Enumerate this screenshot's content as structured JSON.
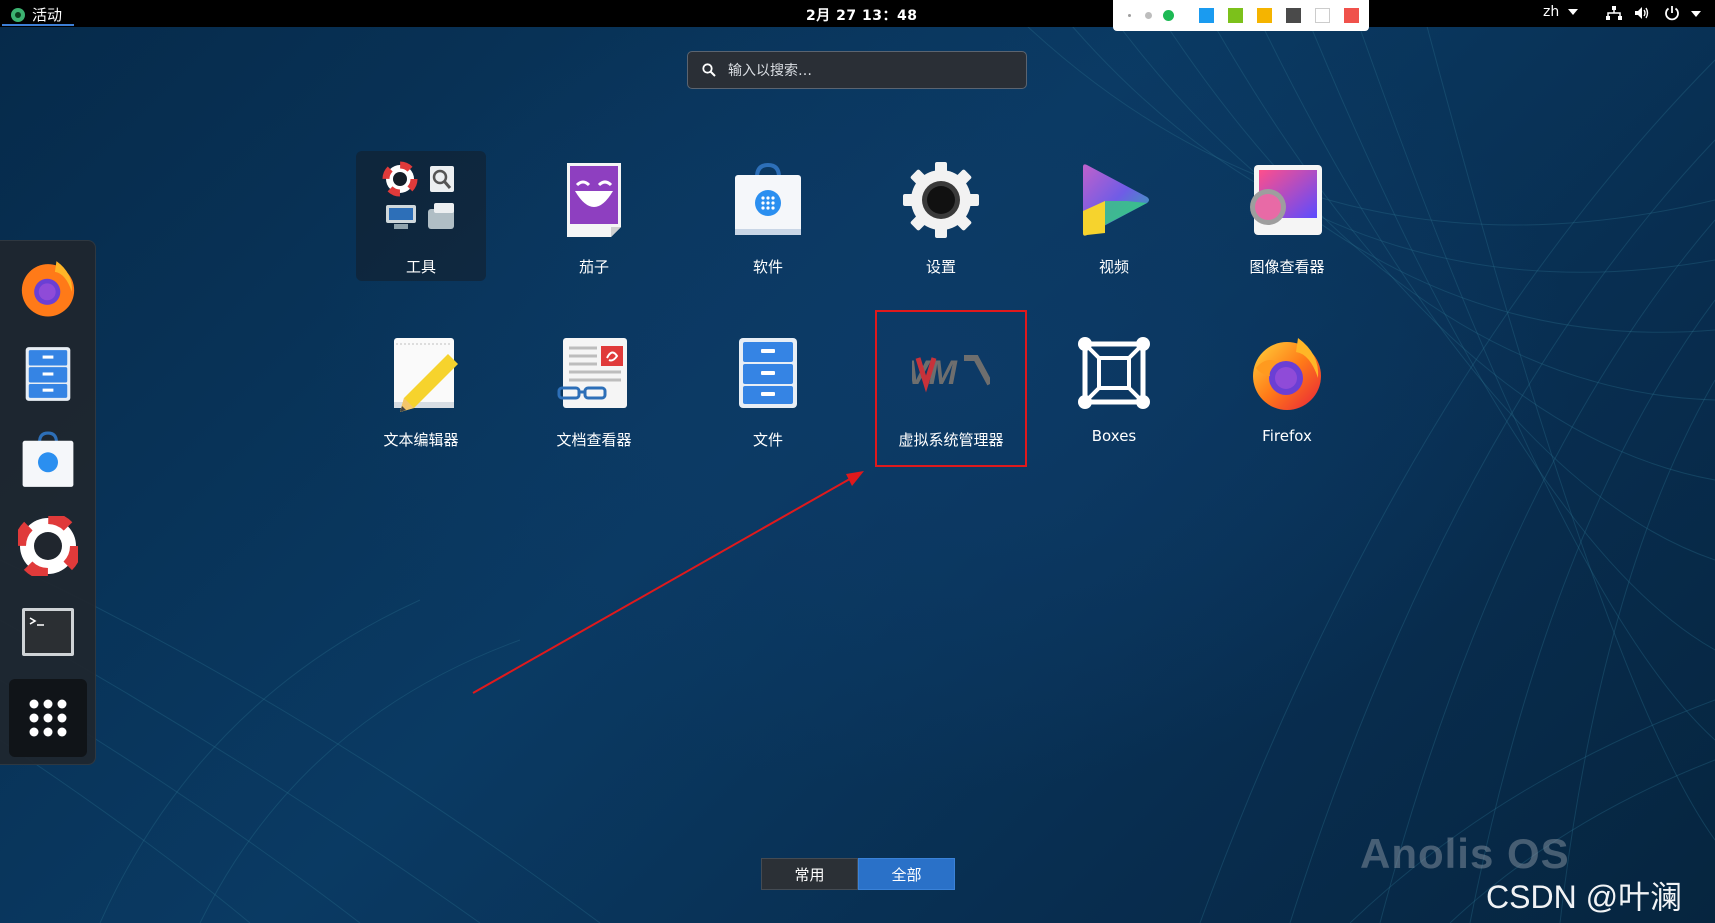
{
  "topbar": {
    "activities_label": "活动",
    "clock": "2月 27  13：48",
    "language": "zh",
    "palette_colors": [
      "#9e9e9e",
      "#bdbdbd",
      "#1db954",
      "#1a9bf0",
      "#7cc11b",
      "#f5b400",
      "#4a4a4a",
      "#ffffff",
      "#f0514b"
    ]
  },
  "search": {
    "placeholder": "输入以搜索…"
  },
  "apps": [
    {
      "label": "工具",
      "icon": "utilities-folder-icon"
    },
    {
      "label": "茄子",
      "icon": "cheese-icon"
    },
    {
      "label": "软件",
      "icon": "software-icon"
    },
    {
      "label": "设置",
      "icon": "settings-gear-icon"
    },
    {
      "label": "视频",
      "icon": "videos-icon"
    },
    {
      "label": "图像查看器",
      "icon": "image-viewer-icon"
    },
    {
      "label": "文本编辑器",
      "icon": "text-editor-icon"
    },
    {
      "label": "文档查看器",
      "icon": "document-viewer-icon"
    },
    {
      "label": "文件",
      "icon": "files-icon"
    },
    {
      "label": "虚拟系统管理器",
      "icon": "virt-manager-icon",
      "logo_text": "VM"
    },
    {
      "label": "Boxes",
      "icon": "boxes-icon"
    },
    {
      "label": "Firefox",
      "icon": "firefox-icon"
    }
  ],
  "dock": [
    "firefox-icon",
    "files-icon",
    "software-icon",
    "help-icon",
    "terminal-icon",
    "show-apps-icon"
  ],
  "switcher": {
    "frequent": "常用",
    "all": "全部"
  },
  "watermarks": {
    "os": "Anolis OS",
    "csdn": "CSDN @叶澜"
  }
}
